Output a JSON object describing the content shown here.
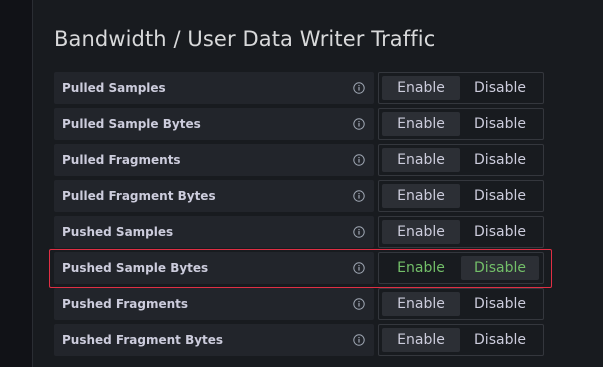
{
  "section": {
    "title": "Bandwidth / User Data Writer Traffic"
  },
  "toggle": {
    "enable_label": "Enable",
    "disable_label": "Disable"
  },
  "rows": [
    {
      "label": "Pulled Samples",
      "selected": "Enable"
    },
    {
      "label": "Pulled Sample Bytes",
      "selected": "Enable"
    },
    {
      "label": "Pulled Fragments",
      "selected": "Enable"
    },
    {
      "label": "Pulled Fragment Bytes",
      "selected": "Enable"
    },
    {
      "label": "Pushed Samples",
      "selected": "Enable"
    },
    {
      "label": "Pushed Sample Bytes",
      "selected": "Disable"
    },
    {
      "label": "Pushed Fragments",
      "selected": "Enable"
    },
    {
      "label": "Pushed Fragment Bytes",
      "selected": "Enable"
    }
  ],
  "colors": {
    "highlight_border": "#e02f44",
    "changed_text": "#73bf69",
    "background": "#181b1f"
  },
  "icons": {
    "info": "info-circle-icon"
  }
}
